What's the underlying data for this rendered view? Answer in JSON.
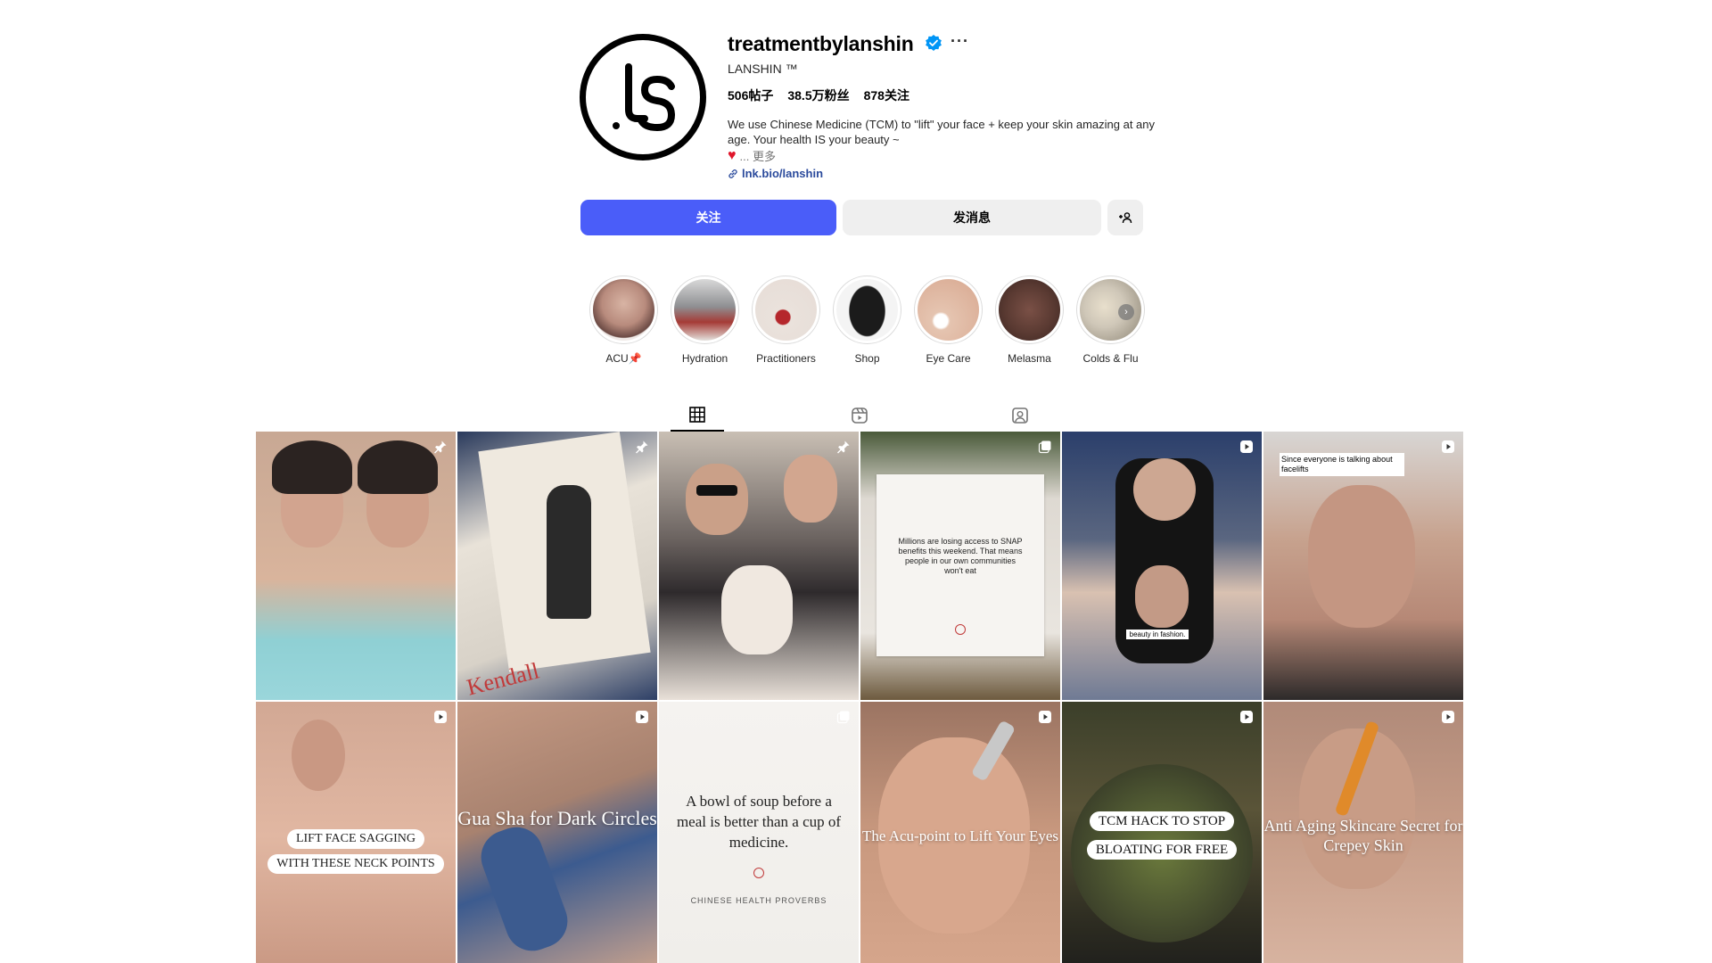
{
  "profile": {
    "username": "treatmentbylanshin",
    "full_name": "LANSHIN ™",
    "more_icon": "ellipsis-icon",
    "verified_icon": "verified-badge-icon",
    "stats": {
      "posts": "506帖子",
      "followers": "38.5万粉丝",
      "following": "878关注"
    },
    "bio": "We use Chinese Medicine (TCM) to \"lift\" your face + keep your skin amazing at any age. Your health IS your beauty ~",
    "more_label": "... 更多",
    "link_text": "lnk.bio/lanshin"
  },
  "actions": {
    "follow_label": "关注",
    "message_label": "发消息",
    "suggest_icon": "add-person-icon"
  },
  "highlights": [
    {
      "label": "ACU📌",
      "color": "#c9a99a"
    },
    {
      "label": "Hydration",
      "color": "#8e8f92"
    },
    {
      "label": "Practitioners",
      "color": "#e6dcd6"
    },
    {
      "label": "Shop",
      "color": "#f4f4f4"
    },
    {
      "label": "Eye Care",
      "color": "#e5c4b0"
    },
    {
      "label": "Melasma",
      "color": "#5a3a32"
    },
    {
      "label": "Colds & Flu",
      "color": "#cfc7b8"
    }
  ],
  "tabs": [
    "grid-icon",
    "reels-icon",
    "tagged-icon"
  ],
  "posts": [
    {
      "text": "",
      "badge": "pin-icon",
      "bg": "linear-gradient(180deg,#c8a894 0%,#d9b49c 55%,#8fd0d4 78%,#9ad6db 100%)"
    },
    {
      "text": "Kendall",
      "badge": "pin-icon",
      "bg": "linear-gradient(160deg,#2a3a5c 0%,#e8e2d8 35%,#d8d2c8 70%,#2d3f66 100%)"
    },
    {
      "text": "",
      "badge": "pin-icon",
      "bg": "linear-gradient(180deg,#c9bfb4 0%,#6b6360 40%,#2e2a2c 60%,#e8e0d8 100%)"
    },
    {
      "text": "Millions are losing access to SNAP benefits this weekend. That means people in our own communities won't eat",
      "badge": "carousel-icon",
      "bg": "linear-gradient(180deg,#4a5a3a 0%,#ded9d2 25%,#e9e5df 75%,#6d5a3e 100%)"
    },
    {
      "text": "beauty in fashion.",
      "badge": "reel-icon",
      "bg": "linear-gradient(180deg,#2b3f6b 0%,#5a6680 40%,#d9c1b1 60%,#6f7a94 100%)"
    },
    {
      "text": "Since everyone is talking about facelifts",
      "badge": "reel-icon",
      "bg": "linear-gradient(180deg,#d8d6d4 0%,#c7a28e 40%,#b68876 70%,#2d2a2a 100%)"
    },
    {
      "text": "LIFT FACE SAGGING WITH THESE NECK POINTS",
      "badge": "reel-icon",
      "bg": "linear-gradient(180deg,#d2a894 0%,#e1b7a2 50%,#c99883 100%)"
    },
    {
      "text": "Gua Sha for Dark Circles",
      "badge": "reel-icon",
      "bg": "linear-gradient(160deg,#c59a84 0%,#a8826f 40%,#3c5b8f 60%,#c8a28d 100%)"
    },
    {
      "text": "A bowl of soup before a meal is better than a cup of medicine.",
      "caption": "CHINESE HEALTH PROVERBS",
      "badge": "carousel-icon",
      "bg": "linear-gradient(180deg,#f5f3f0 0%,#f0eeea 100%)"
    },
    {
      "text": "The Acu-point to Lift Your Eyes",
      "badge": "reel-icon",
      "bg": "linear-gradient(180deg,#9b7462 0%,#c9997f 50%,#d6a68c 100%)"
    },
    {
      "text": "TCM HACK TO STOP BLOATING FOR FREE",
      "badge": "reel-icon",
      "bg": "linear-gradient(180deg,#3b3f2a 0%,#5a5438 40%,#2f2e22 80%,#1f1f1c 100%)"
    },
    {
      "text": "Anti Aging Skincare Secret for Crepey Skin",
      "badge": "reel-icon",
      "bg": "linear-gradient(180deg,#b08a79 0%,#c59b86 45%,#d8b4a1 100%)"
    }
  ]
}
